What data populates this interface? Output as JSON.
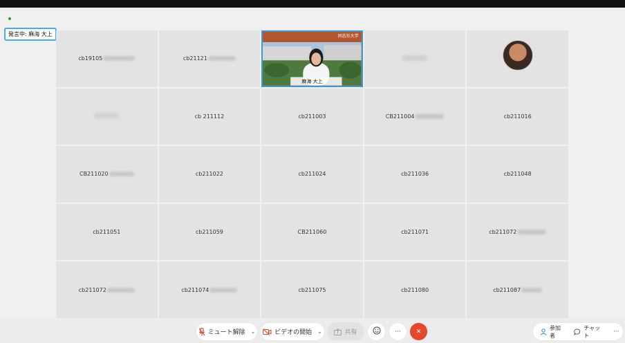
{
  "speaking": {
    "label": "発言中: 麻海 大上"
  },
  "video_tile": {
    "caption": "麻海 大上",
    "banner_text": "同志社大学"
  },
  "tiles": [
    {
      "name": "cb19105",
      "blur": 46
    },
    {
      "name": "cb21121",
      "blur": 40
    },
    {
      "name": "",
      "video": true
    },
    {
      "name": "",
      "blur": 38
    },
    {
      "name": "",
      "avatar": true
    },
    {
      "name": "",
      "blur": 36
    },
    {
      "name": "cb 211112"
    },
    {
      "name": "cb211003"
    },
    {
      "name": "CB211004",
      "blur": 42
    },
    {
      "name": "cb211016"
    },
    {
      "name": "CB211020",
      "blur": 36
    },
    {
      "name": "cb211022"
    },
    {
      "name": "cb211024"
    },
    {
      "name": "cb211036"
    },
    {
      "name": "cb211048"
    },
    {
      "name": "cb211051"
    },
    {
      "name": "cb211059"
    },
    {
      "name": "CB211060"
    },
    {
      "name": "cb211071"
    },
    {
      "name": "cb211072",
      "blur": 42
    },
    {
      "name": "cb211072",
      "blur": 40
    },
    {
      "name": "cb211074",
      "blur": 40
    },
    {
      "name": "cb211075"
    },
    {
      "name": "cb211080"
    },
    {
      "name": "cb211087",
      "blur": 30
    }
  ],
  "toolbar": {
    "unmute_label": "ミュート解除",
    "video_label": "ビデオの開始",
    "share_label": "共有",
    "more_label": "···",
    "end_label": "✕",
    "participants_label": "参加者",
    "chat_label": "チャット",
    "overflow_label": "···"
  },
  "colors": {
    "accent": "#3a9ad9",
    "end_button": "#e4472b",
    "tile_bg": "#e3e3e3"
  }
}
